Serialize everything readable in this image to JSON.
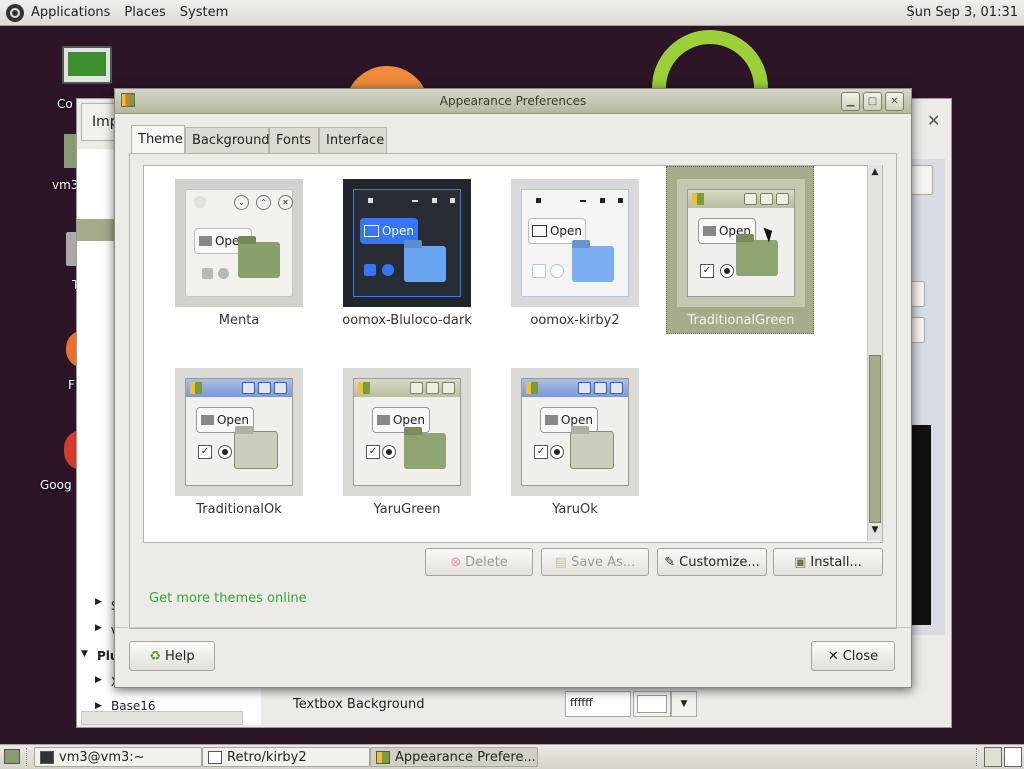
{
  "top_panel": {
    "menus": [
      "Applications",
      "Places",
      "System"
    ],
    "clock": "Sun Sep  3, 01:31"
  },
  "desktop": {
    "icon_labels": [
      "Co",
      "vm3",
      "T",
      "F",
      "Goog"
    ]
  },
  "background_window": {
    "tab_label": "Imp",
    "tree_items": [
      "S",
      "V",
      "Plu",
      "X",
      "Base16"
    ],
    "field_label": "Textbox Background",
    "field_value": "ffffff"
  },
  "dialog": {
    "title": "Appearance Preferences",
    "tabs": [
      "Theme",
      "Background",
      "Fonts",
      "Interface"
    ],
    "active_tab": "Theme",
    "themes": [
      {
        "name": "Menta",
        "style": "menta",
        "selected": false
      },
      {
        "name": "oomox-Bluloco-dark",
        "style": "bluloco",
        "selected": false
      },
      {
        "name": "oomox-kirby2",
        "style": "kirby",
        "selected": false
      },
      {
        "name": "TraditionalGreen",
        "style": "tradgreen",
        "selected": true
      },
      {
        "name": "TraditionalOk",
        "style": "tradok",
        "selected": false
      },
      {
        "name": "YaruGreen",
        "style": "yarugreen",
        "selected": false
      },
      {
        "name": "YaruOk",
        "style": "yaruok",
        "selected": false
      }
    ],
    "preview_button_label": "Open",
    "buttons": {
      "delete": "Delete",
      "save_as": "Save As...",
      "customize": "Customize...",
      "install": "Install...",
      "help": "Help",
      "close": "Close"
    },
    "more_themes_link": "Get more themes online"
  },
  "taskbar": {
    "tasks": [
      "vm3@vm3:~",
      "Retro/kirby2",
      "Appearance Prefere..."
    ]
  }
}
